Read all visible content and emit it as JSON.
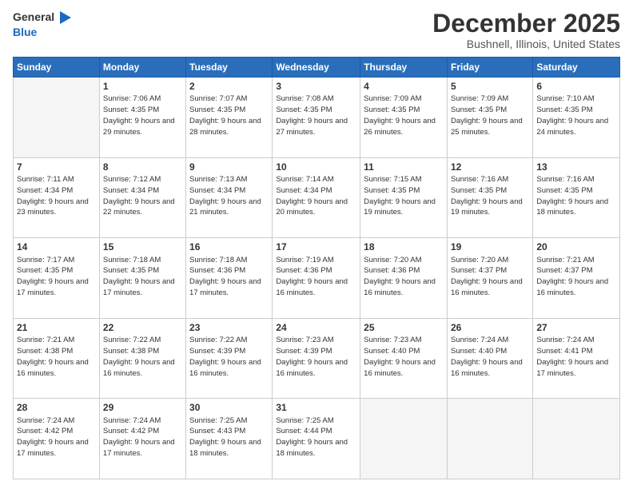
{
  "header": {
    "logo_general": "General",
    "logo_blue": "Blue",
    "main_title": "December 2025",
    "subtitle": "Bushnell, Illinois, United States"
  },
  "calendar": {
    "days_of_week": [
      "Sunday",
      "Monday",
      "Tuesday",
      "Wednesday",
      "Thursday",
      "Friday",
      "Saturday"
    ],
    "weeks": [
      [
        {
          "day": "",
          "sunrise": "",
          "sunset": "",
          "daylight": ""
        },
        {
          "day": "1",
          "sunrise": "Sunrise: 7:06 AM",
          "sunset": "Sunset: 4:35 PM",
          "daylight": "Daylight: 9 hours and 29 minutes."
        },
        {
          "day": "2",
          "sunrise": "Sunrise: 7:07 AM",
          "sunset": "Sunset: 4:35 PM",
          "daylight": "Daylight: 9 hours and 28 minutes."
        },
        {
          "day": "3",
          "sunrise": "Sunrise: 7:08 AM",
          "sunset": "Sunset: 4:35 PM",
          "daylight": "Daylight: 9 hours and 27 minutes."
        },
        {
          "day": "4",
          "sunrise": "Sunrise: 7:09 AM",
          "sunset": "Sunset: 4:35 PM",
          "daylight": "Daylight: 9 hours and 26 minutes."
        },
        {
          "day": "5",
          "sunrise": "Sunrise: 7:09 AM",
          "sunset": "Sunset: 4:35 PM",
          "daylight": "Daylight: 9 hours and 25 minutes."
        },
        {
          "day": "6",
          "sunrise": "Sunrise: 7:10 AM",
          "sunset": "Sunset: 4:35 PM",
          "daylight": "Daylight: 9 hours and 24 minutes."
        }
      ],
      [
        {
          "day": "7",
          "sunrise": "Sunrise: 7:11 AM",
          "sunset": "Sunset: 4:34 PM",
          "daylight": "Daylight: 9 hours and 23 minutes."
        },
        {
          "day": "8",
          "sunrise": "Sunrise: 7:12 AM",
          "sunset": "Sunset: 4:34 PM",
          "daylight": "Daylight: 9 hours and 22 minutes."
        },
        {
          "day": "9",
          "sunrise": "Sunrise: 7:13 AM",
          "sunset": "Sunset: 4:34 PM",
          "daylight": "Daylight: 9 hours and 21 minutes."
        },
        {
          "day": "10",
          "sunrise": "Sunrise: 7:14 AM",
          "sunset": "Sunset: 4:34 PM",
          "daylight": "Daylight: 9 hours and 20 minutes."
        },
        {
          "day": "11",
          "sunrise": "Sunrise: 7:15 AM",
          "sunset": "Sunset: 4:35 PM",
          "daylight": "Daylight: 9 hours and 19 minutes."
        },
        {
          "day": "12",
          "sunrise": "Sunrise: 7:16 AM",
          "sunset": "Sunset: 4:35 PM",
          "daylight": "Daylight: 9 hours and 19 minutes."
        },
        {
          "day": "13",
          "sunrise": "Sunrise: 7:16 AM",
          "sunset": "Sunset: 4:35 PM",
          "daylight": "Daylight: 9 hours and 18 minutes."
        }
      ],
      [
        {
          "day": "14",
          "sunrise": "Sunrise: 7:17 AM",
          "sunset": "Sunset: 4:35 PM",
          "daylight": "Daylight: 9 hours and 17 minutes."
        },
        {
          "day": "15",
          "sunrise": "Sunrise: 7:18 AM",
          "sunset": "Sunset: 4:35 PM",
          "daylight": "Daylight: 9 hours and 17 minutes."
        },
        {
          "day": "16",
          "sunrise": "Sunrise: 7:18 AM",
          "sunset": "Sunset: 4:36 PM",
          "daylight": "Daylight: 9 hours and 17 minutes."
        },
        {
          "day": "17",
          "sunrise": "Sunrise: 7:19 AM",
          "sunset": "Sunset: 4:36 PM",
          "daylight": "Daylight: 9 hours and 16 minutes."
        },
        {
          "day": "18",
          "sunrise": "Sunrise: 7:20 AM",
          "sunset": "Sunset: 4:36 PM",
          "daylight": "Daylight: 9 hours and 16 minutes."
        },
        {
          "day": "19",
          "sunrise": "Sunrise: 7:20 AM",
          "sunset": "Sunset: 4:37 PM",
          "daylight": "Daylight: 9 hours and 16 minutes."
        },
        {
          "day": "20",
          "sunrise": "Sunrise: 7:21 AM",
          "sunset": "Sunset: 4:37 PM",
          "daylight": "Daylight: 9 hours and 16 minutes."
        }
      ],
      [
        {
          "day": "21",
          "sunrise": "Sunrise: 7:21 AM",
          "sunset": "Sunset: 4:38 PM",
          "daylight": "Daylight: 9 hours and 16 minutes."
        },
        {
          "day": "22",
          "sunrise": "Sunrise: 7:22 AM",
          "sunset": "Sunset: 4:38 PM",
          "daylight": "Daylight: 9 hours and 16 minutes."
        },
        {
          "day": "23",
          "sunrise": "Sunrise: 7:22 AM",
          "sunset": "Sunset: 4:39 PM",
          "daylight": "Daylight: 9 hours and 16 minutes."
        },
        {
          "day": "24",
          "sunrise": "Sunrise: 7:23 AM",
          "sunset": "Sunset: 4:39 PM",
          "daylight": "Daylight: 9 hours and 16 minutes."
        },
        {
          "day": "25",
          "sunrise": "Sunrise: 7:23 AM",
          "sunset": "Sunset: 4:40 PM",
          "daylight": "Daylight: 9 hours and 16 minutes."
        },
        {
          "day": "26",
          "sunrise": "Sunrise: 7:24 AM",
          "sunset": "Sunset: 4:40 PM",
          "daylight": "Daylight: 9 hours and 16 minutes."
        },
        {
          "day": "27",
          "sunrise": "Sunrise: 7:24 AM",
          "sunset": "Sunset: 4:41 PM",
          "daylight": "Daylight: 9 hours and 17 minutes."
        }
      ],
      [
        {
          "day": "28",
          "sunrise": "Sunrise: 7:24 AM",
          "sunset": "Sunset: 4:42 PM",
          "daylight": "Daylight: 9 hours and 17 minutes."
        },
        {
          "day": "29",
          "sunrise": "Sunrise: 7:24 AM",
          "sunset": "Sunset: 4:42 PM",
          "daylight": "Daylight: 9 hours and 17 minutes."
        },
        {
          "day": "30",
          "sunrise": "Sunrise: 7:25 AM",
          "sunset": "Sunset: 4:43 PM",
          "daylight": "Daylight: 9 hours and 18 minutes."
        },
        {
          "day": "31",
          "sunrise": "Sunrise: 7:25 AM",
          "sunset": "Sunset: 4:44 PM",
          "daylight": "Daylight: 9 hours and 18 minutes."
        },
        {
          "day": "",
          "sunrise": "",
          "sunset": "",
          "daylight": ""
        },
        {
          "day": "",
          "sunrise": "",
          "sunset": "",
          "daylight": ""
        },
        {
          "day": "",
          "sunrise": "",
          "sunset": "",
          "daylight": ""
        }
      ]
    ]
  }
}
